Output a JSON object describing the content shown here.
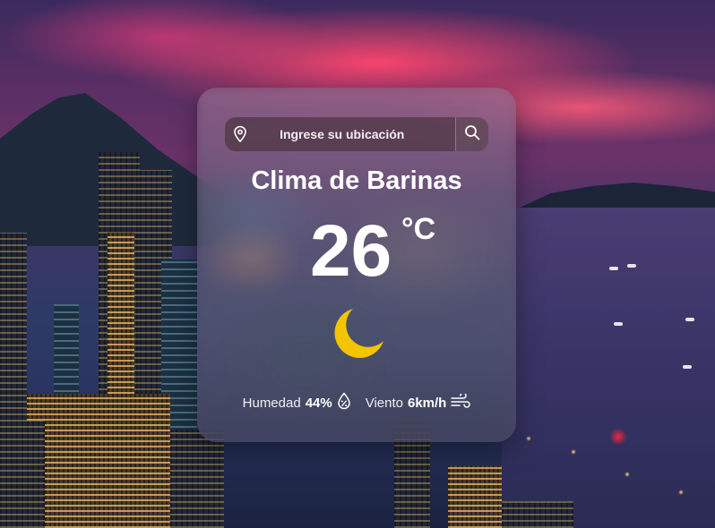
{
  "search": {
    "placeholder": "Ingrese su ubicación"
  },
  "weather": {
    "title": "Clima de Barinas",
    "temperature": "26",
    "unit": "°C",
    "condition_icon": "moon-icon",
    "humidity_label": "Humedad",
    "humidity_value": "44%",
    "wind_label": "Viento",
    "wind_value": "6km/h"
  },
  "icons": {
    "location": "location-pin-icon",
    "search": "search-icon",
    "humidity": "droplet-percent-icon",
    "wind": "wind-icon"
  },
  "colors": {
    "moon": "#f2c500",
    "text": "#ffffff"
  }
}
